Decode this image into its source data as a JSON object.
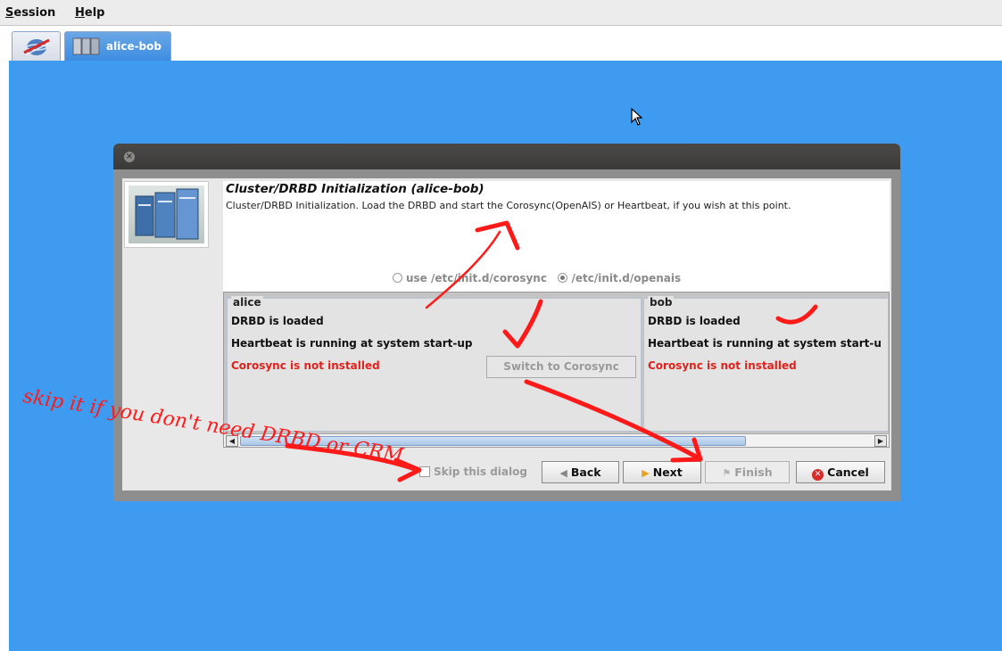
{
  "menubar": {
    "items": [
      {
        "mnemonic": "S",
        "rest": "ession"
      },
      {
        "mnemonic": "H",
        "rest": "elp"
      }
    ]
  },
  "tabs": [
    {
      "icon": "cluster-globe-icon",
      "label": ""
    },
    {
      "icon": "host-servers-icon",
      "label": "alice-bob"
    }
  ],
  "dialog": {
    "title": "Cluster/DRBD Initialization (alice-bob)",
    "description": "Cluster/DRBD Initialization. Load the DRBD and start the Corosync(OpenAIS) or Heartbeat, if you wish at this point.",
    "init_options": [
      {
        "label": "use /etc/init.d/corosync",
        "selected": false
      },
      {
        "label": "/etc/init.d/openais",
        "selected": true
      }
    ],
    "hosts": [
      {
        "name": "alice",
        "drbd_status": "DRBD is loaded",
        "heartbeat_status": "Heartbeat is running at system start-up",
        "corosync_status": "Corosync is not installed",
        "switch_button": "Switch to Corosync"
      },
      {
        "name": "bob",
        "drbd_status": "DRBD is loaded",
        "heartbeat_status": "Heartbeat is running at system start-u",
        "corosync_status": "Corosync is not installed"
      }
    ],
    "skip_label": "Skip this dialog",
    "buttons": {
      "back": "Back",
      "next": "Next",
      "finish": "Finish",
      "cancel": "Cancel"
    }
  },
  "annotation": {
    "note_line1": "skip it if you don't need DRBD or CRM",
    "color": "#ff1a1a"
  },
  "colors": {
    "desktop_blue": "#3e9bf0",
    "error_red": "#e0221c",
    "tab_active": "#3d8de2"
  }
}
